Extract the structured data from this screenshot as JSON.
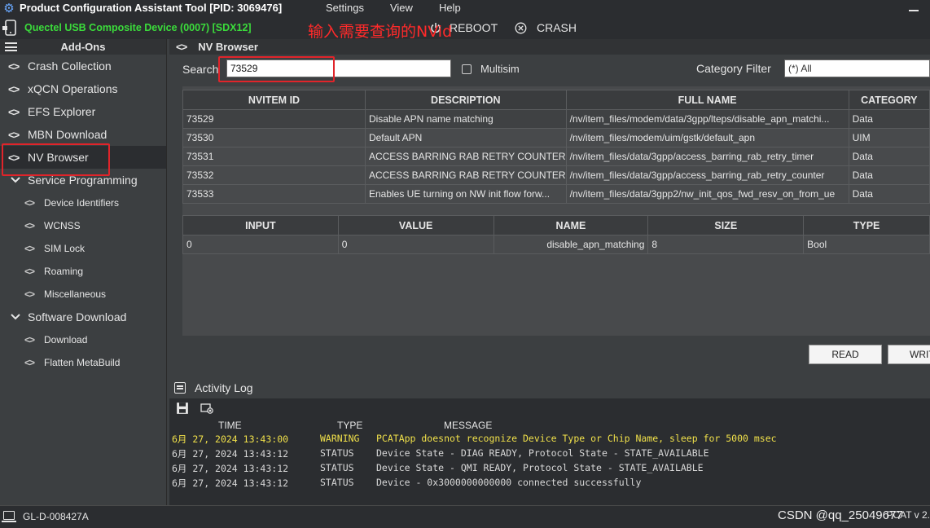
{
  "window": {
    "title": "Product Configuration Assistant Tool [PID: 3069476]",
    "menu": [
      "Settings",
      "View",
      "Help"
    ]
  },
  "device": {
    "name": "Quectel USB Composite Device (0007) [SDX12]",
    "reboot_label": "REBOOT",
    "crash_label": "CRASH"
  },
  "annotation": "输入需要查询的NVid",
  "sidebar": {
    "header": "Add-Ons",
    "items": [
      {
        "label": "Crash Collection"
      },
      {
        "label": "xQCN Operations"
      },
      {
        "label": "EFS Explorer"
      },
      {
        "label": "MBN Download"
      },
      {
        "label": "NV Browser"
      },
      {
        "label": "Service Programming"
      },
      {
        "label": "Device Identifiers"
      },
      {
        "label": "WCNSS"
      },
      {
        "label": "SIM Lock"
      },
      {
        "label": "Roaming"
      },
      {
        "label": "Miscellaneous"
      },
      {
        "label": "Software Download"
      },
      {
        "label": "Download"
      },
      {
        "label": "Flatten MetaBuild"
      }
    ]
  },
  "nv_browser": {
    "header": "NV Browser",
    "search_label": "Search",
    "search_value": "73529",
    "multisim_label": "Multisim",
    "category_label": "Category Filter",
    "category_value": "(*) All",
    "nv_columns": [
      "NVITEM ID",
      "DESCRIPTION",
      "FULL NAME",
      "CATEGORY"
    ],
    "nv_rows": [
      [
        "73529",
        "Disable APN name matching",
        "/nv/item_files/modem/data/3gpp/lteps/disable_apn_matchi...",
        "Data"
      ],
      [
        "73530",
        "Default APN",
        "/nv/item_files/modem/uim/gstk/default_apn",
        "UIM"
      ],
      [
        "73531",
        "ACCESS BARRING RAB RETRY COUNTER",
        "/nv/item_files/data/3gpp/access_barring_rab_retry_timer",
        "Data"
      ],
      [
        "73532",
        "ACCESS BARRING RAB RETRY COUNTER",
        "/nv/item_files/data/3gpp/access_barring_rab_retry_counter",
        "Data"
      ],
      [
        "73533",
        "Enables UE turning on NW init flow forw...",
        "/nv/item_files/data/3gpp2/nw_init_qos_fwd_resv_on_from_ue",
        "Data"
      ]
    ],
    "value_columns": [
      "INPUT",
      "VALUE",
      "NAME",
      "SIZE",
      "TYPE"
    ],
    "value_rows": [
      [
        "0",
        "0",
        "disable_apn_matching",
        "8",
        "Bool"
      ]
    ],
    "read_label": "READ",
    "write_label": "WRIT"
  },
  "activity": {
    "title": "Activity Log",
    "columns": [
      "TIME",
      "TYPE",
      "MESSAGE"
    ],
    "entries": [
      {
        "time": "6月 27, 2024  13:43:00",
        "type": "WARNING",
        "message": "PCATApp doesnot recognize Device Type or Chip Name, sleep for 5000 msec"
      },
      {
        "time": "6月 27, 2024  13:43:12",
        "type": "STATUS",
        "message": "Device State - DIAG READY, Protocol State - STATE_AVAILABLE"
      },
      {
        "time": "6月 27, 2024  13:43:12",
        "type": "STATUS",
        "message": "Device State - QMI READY, Protocol State - STATE_AVAILABLE"
      },
      {
        "time": "6月 27, 2024  13:43:12",
        "type": "STATUS",
        "message": "Device - 0x3000000000000 connected successfully"
      }
    ]
  },
  "statusbar": {
    "host": "GL-D-008427A",
    "watermark": "CSDN @qq_25049677",
    "version": "PCAT v 2."
  },
  "colors": {
    "device_green": "#3bdc3b",
    "highlight_red": "#e0242a",
    "warning_yellow": "#f0e04a"
  }
}
